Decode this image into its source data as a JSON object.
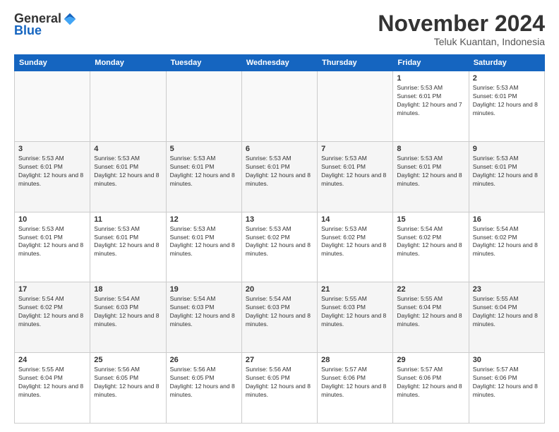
{
  "logo": {
    "general": "General",
    "blue": "Blue"
  },
  "title": "November 2024",
  "location": "Teluk Kuantan, Indonesia",
  "headers": [
    "Sunday",
    "Monday",
    "Tuesday",
    "Wednesday",
    "Thursday",
    "Friday",
    "Saturday"
  ],
  "weeks": [
    [
      {
        "day": "",
        "empty": true
      },
      {
        "day": "",
        "empty": true
      },
      {
        "day": "",
        "empty": true
      },
      {
        "day": "",
        "empty": true
      },
      {
        "day": "",
        "empty": true
      },
      {
        "day": "1",
        "sunrise": "Sunrise: 5:53 AM",
        "sunset": "Sunset: 6:01 PM",
        "daylight": "Daylight: 12 hours and 7 minutes."
      },
      {
        "day": "2",
        "sunrise": "Sunrise: 5:53 AM",
        "sunset": "Sunset: 6:01 PM",
        "daylight": "Daylight: 12 hours and 8 minutes."
      }
    ],
    [
      {
        "day": "3",
        "sunrise": "Sunrise: 5:53 AM",
        "sunset": "Sunset: 6:01 PM",
        "daylight": "Daylight: 12 hours and 8 minutes."
      },
      {
        "day": "4",
        "sunrise": "Sunrise: 5:53 AM",
        "sunset": "Sunset: 6:01 PM",
        "daylight": "Daylight: 12 hours and 8 minutes."
      },
      {
        "day": "5",
        "sunrise": "Sunrise: 5:53 AM",
        "sunset": "Sunset: 6:01 PM",
        "daylight": "Daylight: 12 hours and 8 minutes."
      },
      {
        "day": "6",
        "sunrise": "Sunrise: 5:53 AM",
        "sunset": "Sunset: 6:01 PM",
        "daylight": "Daylight: 12 hours and 8 minutes."
      },
      {
        "day": "7",
        "sunrise": "Sunrise: 5:53 AM",
        "sunset": "Sunset: 6:01 PM",
        "daylight": "Daylight: 12 hours and 8 minutes."
      },
      {
        "day": "8",
        "sunrise": "Sunrise: 5:53 AM",
        "sunset": "Sunset: 6:01 PM",
        "daylight": "Daylight: 12 hours and 8 minutes."
      },
      {
        "day": "9",
        "sunrise": "Sunrise: 5:53 AM",
        "sunset": "Sunset: 6:01 PM",
        "daylight": "Daylight: 12 hours and 8 minutes."
      }
    ],
    [
      {
        "day": "10",
        "sunrise": "Sunrise: 5:53 AM",
        "sunset": "Sunset: 6:01 PM",
        "daylight": "Daylight: 12 hours and 8 minutes."
      },
      {
        "day": "11",
        "sunrise": "Sunrise: 5:53 AM",
        "sunset": "Sunset: 6:01 PM",
        "daylight": "Daylight: 12 hours and 8 minutes."
      },
      {
        "day": "12",
        "sunrise": "Sunrise: 5:53 AM",
        "sunset": "Sunset: 6:01 PM",
        "daylight": "Daylight: 12 hours and 8 minutes."
      },
      {
        "day": "13",
        "sunrise": "Sunrise: 5:53 AM",
        "sunset": "Sunset: 6:02 PM",
        "daylight": "Daylight: 12 hours and 8 minutes."
      },
      {
        "day": "14",
        "sunrise": "Sunrise: 5:53 AM",
        "sunset": "Sunset: 6:02 PM",
        "daylight": "Daylight: 12 hours and 8 minutes."
      },
      {
        "day": "15",
        "sunrise": "Sunrise: 5:54 AM",
        "sunset": "Sunset: 6:02 PM",
        "daylight": "Daylight: 12 hours and 8 minutes."
      },
      {
        "day": "16",
        "sunrise": "Sunrise: 5:54 AM",
        "sunset": "Sunset: 6:02 PM",
        "daylight": "Daylight: 12 hours and 8 minutes."
      }
    ],
    [
      {
        "day": "17",
        "sunrise": "Sunrise: 5:54 AM",
        "sunset": "Sunset: 6:02 PM",
        "daylight": "Daylight: 12 hours and 8 minutes."
      },
      {
        "day": "18",
        "sunrise": "Sunrise: 5:54 AM",
        "sunset": "Sunset: 6:03 PM",
        "daylight": "Daylight: 12 hours and 8 minutes."
      },
      {
        "day": "19",
        "sunrise": "Sunrise: 5:54 AM",
        "sunset": "Sunset: 6:03 PM",
        "daylight": "Daylight: 12 hours and 8 minutes."
      },
      {
        "day": "20",
        "sunrise": "Sunrise: 5:54 AM",
        "sunset": "Sunset: 6:03 PM",
        "daylight": "Daylight: 12 hours and 8 minutes."
      },
      {
        "day": "21",
        "sunrise": "Sunrise: 5:55 AM",
        "sunset": "Sunset: 6:03 PM",
        "daylight": "Daylight: 12 hours and 8 minutes."
      },
      {
        "day": "22",
        "sunrise": "Sunrise: 5:55 AM",
        "sunset": "Sunset: 6:04 PM",
        "daylight": "Daylight: 12 hours and 8 minutes."
      },
      {
        "day": "23",
        "sunrise": "Sunrise: 5:55 AM",
        "sunset": "Sunset: 6:04 PM",
        "daylight": "Daylight: 12 hours and 8 minutes."
      }
    ],
    [
      {
        "day": "24",
        "sunrise": "Sunrise: 5:55 AM",
        "sunset": "Sunset: 6:04 PM",
        "daylight": "Daylight: 12 hours and 8 minutes."
      },
      {
        "day": "25",
        "sunrise": "Sunrise: 5:56 AM",
        "sunset": "Sunset: 6:05 PM",
        "daylight": "Daylight: 12 hours and 8 minutes."
      },
      {
        "day": "26",
        "sunrise": "Sunrise: 5:56 AM",
        "sunset": "Sunset: 6:05 PM",
        "daylight": "Daylight: 12 hours and 8 minutes."
      },
      {
        "day": "27",
        "sunrise": "Sunrise: 5:56 AM",
        "sunset": "Sunset: 6:05 PM",
        "daylight": "Daylight: 12 hours and 8 minutes."
      },
      {
        "day": "28",
        "sunrise": "Sunrise: 5:57 AM",
        "sunset": "Sunset: 6:06 PM",
        "daylight": "Daylight: 12 hours and 8 minutes."
      },
      {
        "day": "29",
        "sunrise": "Sunrise: 5:57 AM",
        "sunset": "Sunset: 6:06 PM",
        "daylight": "Daylight: 12 hours and 8 minutes."
      },
      {
        "day": "30",
        "sunrise": "Sunrise: 5:57 AM",
        "sunset": "Sunset: 6:06 PM",
        "daylight": "Daylight: 12 hours and 8 minutes."
      }
    ]
  ]
}
